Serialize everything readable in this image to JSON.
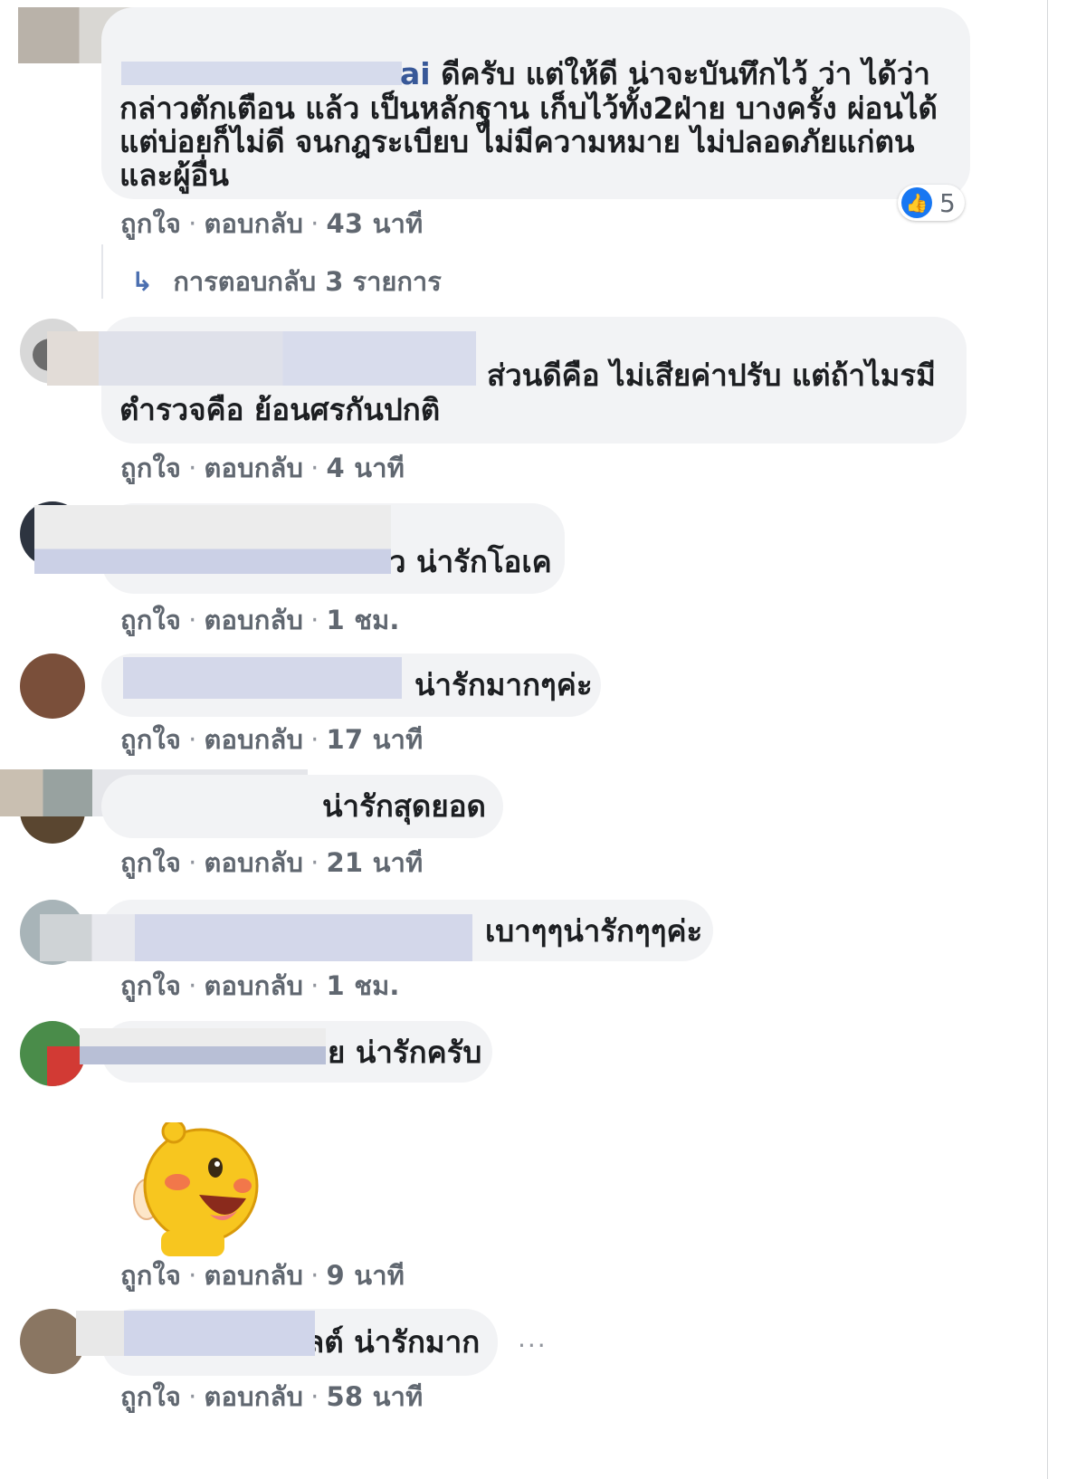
{
  "comments": [
    {
      "text_lines": [
        "ดีครับ แต่ให้ดี น่าจะบันทึกไว้ ว่า ได้ว่า",
        "กล่าวตักเตือน แล้ว เป็นหลักฐาน เก็บไว้ทั้ง2ฝ่าย บางครั้ง ผ่อนได้",
        "แต่บ่อยก็ไม่ดี จนกฎระเบียบ ไม่มีความหมาย ไม่ปลอดภัยแก่ตน",
        "และผู้อื่น"
      ],
      "name_fragment": "ai",
      "like": "ถูกใจ",
      "reply": "ตอบกลับ",
      "time": "43 นาที",
      "reactions": "5"
    },
    {
      "text_lines": [
        "ส่วนดีคือ ไม่เสียค่าปรับ แต่ถ้าไมรมี",
        "ตำรวจคือ ย้อนศรกันปกติ"
      ],
      "like": "ถูกใจ",
      "reply": "ตอบกลับ",
      "time": "4 นาที"
    },
    {
      "text": "ว น่ารักโอเค",
      "like": "ถูกใจ",
      "reply": "ตอบกลับ",
      "time": "1 ชม."
    },
    {
      "text": "น่ารักมากๆค่ะ",
      "like": "ถูกใจ",
      "reply": "ตอบกลับ",
      "time": "17 นาที"
    },
    {
      "text": "น่ารักสุดยอด",
      "like": "ถูกใจ",
      "reply": "ตอบกลับ",
      "time": "21 นาที"
    },
    {
      "text": "เบาๆๆน่ารักๆๆค่ะ",
      "like": "ถูกใจ",
      "reply": "ตอบกลับ",
      "time": "1 ชม."
    },
    {
      "text": "ย น่ารักครับ",
      "like": "ถูกใจ",
      "reply": "ตอบกลับ",
      "time": "9 นาที"
    },
    {
      "text": "ลต์ น่ารักมาก",
      "like": "ถูกใจ",
      "reply": "ตอบกลับ",
      "time": "58 นาที"
    }
  ],
  "replies_link": "การตอบกลับ 3 รายการ",
  "separator": "·",
  "more_options": "···",
  "colors": {
    "bubble": "#f2f3f5",
    "meta": "#606770",
    "blur_blue": "#c9cfe6",
    "like_blue": "#1877f2"
  },
  "icons": [
    "like-reaction-icon",
    "reply-arrow-icon",
    "sticker-icon",
    "more-options-icon"
  ]
}
